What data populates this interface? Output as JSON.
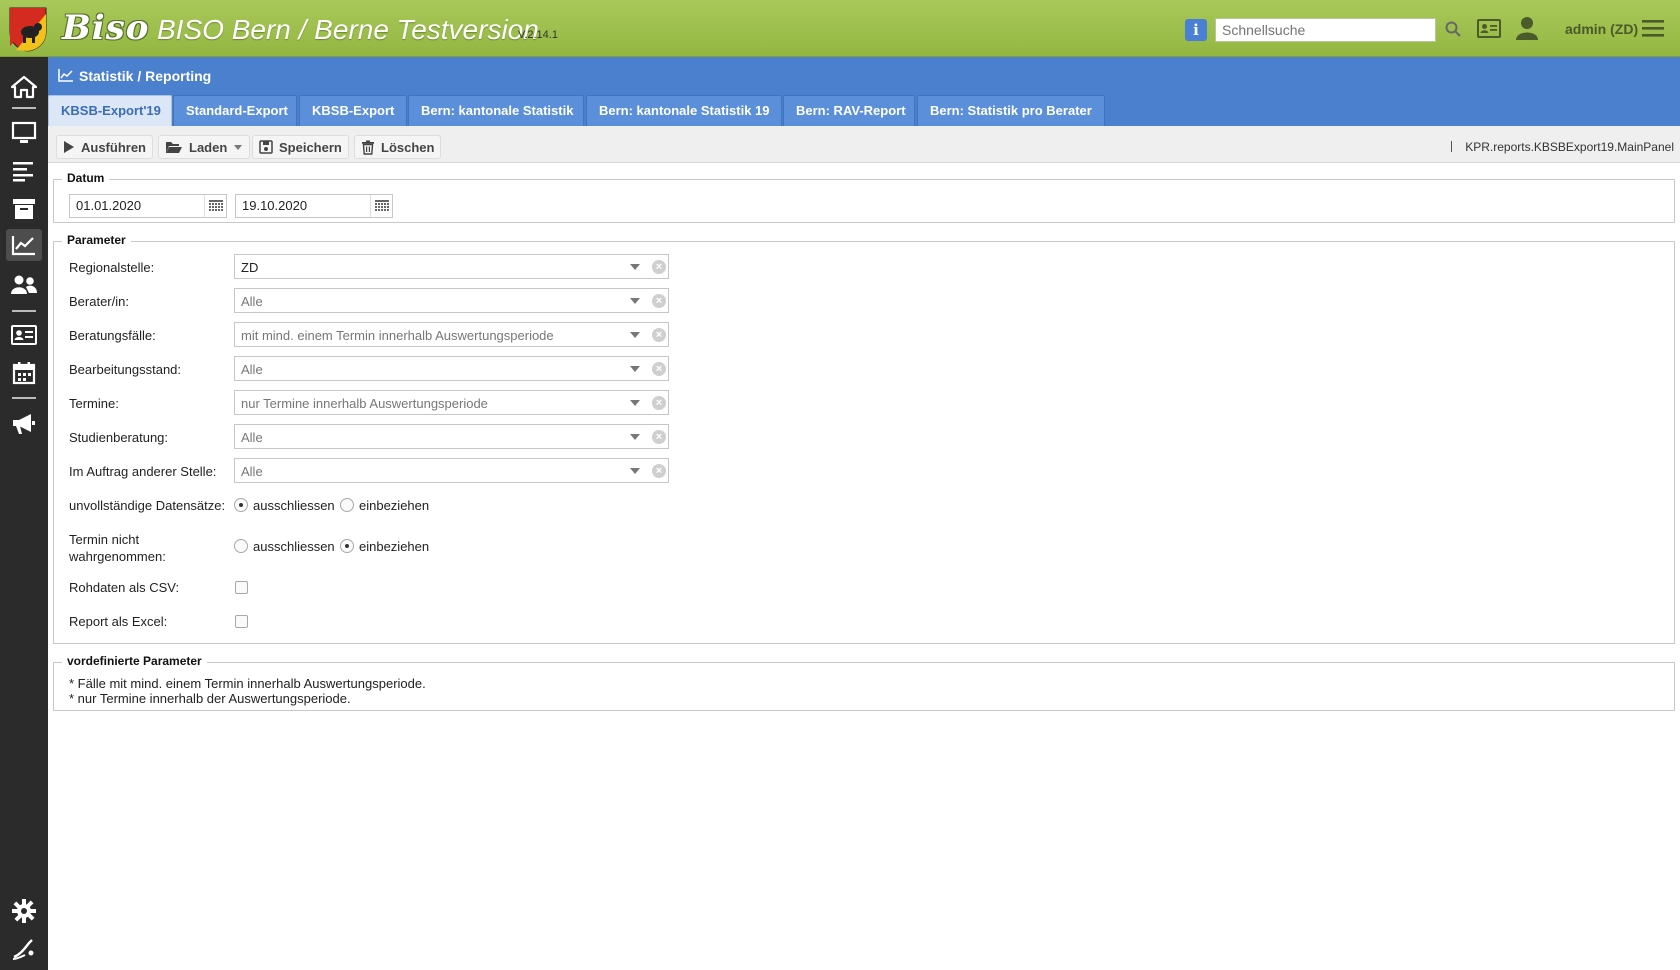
{
  "header": {
    "logo": "Biso",
    "title": "BISO Bern / Berne Testversion",
    "version": "V.2.14.1",
    "search_placeholder": "Schnellsuche",
    "user": "admin (ZD)",
    "brand_color": "#9dbe4b"
  },
  "panel": {
    "title": "Statistik / Reporting",
    "class_name": "KPR.reports.KBSBExport19.MainPanel",
    "accent_color": "#4a80cd"
  },
  "tabs": [
    {
      "label": "KBSB-Export'19",
      "active": true
    },
    {
      "label": "Standard-Export"
    },
    {
      "label": "KBSB-Export"
    },
    {
      "label": "Bern: kantonale Statistik"
    },
    {
      "label": "Bern: kantonale Statistik 19"
    },
    {
      "label": "Bern: RAV-Report"
    },
    {
      "label": "Bern: Statistik pro Berater"
    }
  ],
  "toolbar": {
    "run": "Ausführen",
    "load": "Laden",
    "save": "Speichern",
    "delete": "Löschen"
  },
  "datum": {
    "legend": "Datum",
    "from": "01.01.2020",
    "to": "19.10.2020"
  },
  "parameter": {
    "legend": "Parameter",
    "fields": [
      {
        "label": "Regionalstelle:",
        "value": "ZD",
        "set": true
      },
      {
        "label": "Berater/in:",
        "value": "Alle"
      },
      {
        "label": "Beratungsfälle:",
        "value": "mit mind. einem Termin innerhalb Auswertungsperiode"
      },
      {
        "label": "Bearbeitungsstand:",
        "value": "Alle"
      },
      {
        "label": "Termine:",
        "value": "nur Termine innerhalb Auswertungsperiode"
      },
      {
        "label": "Studienberatung:",
        "value": "Alle"
      },
      {
        "label": "Im Auftrag anderer Stelle:",
        "value": "Alle"
      }
    ],
    "incomplete": {
      "label": "unvollständige Datensätze:",
      "option_exclude": "ausschliessen",
      "option_include": "einbeziehen",
      "selected": "ausschliessen"
    },
    "missed": {
      "label_line1": "Termin nicht",
      "label_line2": "wahrgenommen:",
      "option_exclude": "ausschliessen",
      "option_include": "einbeziehen",
      "selected": "einbeziehen"
    },
    "csv": {
      "label": "Rohdaten als CSV:",
      "checked": false
    },
    "excel": {
      "label": "Report als Excel:",
      "checked": false
    }
  },
  "predefined": {
    "legend": "vordefinierte Parameter",
    "lines": [
      "* Fälle mit mind. einem Termin innerhalb Auswertungsperiode.",
      "* nur Termine innerhalb der Auswertungsperiode."
    ]
  }
}
